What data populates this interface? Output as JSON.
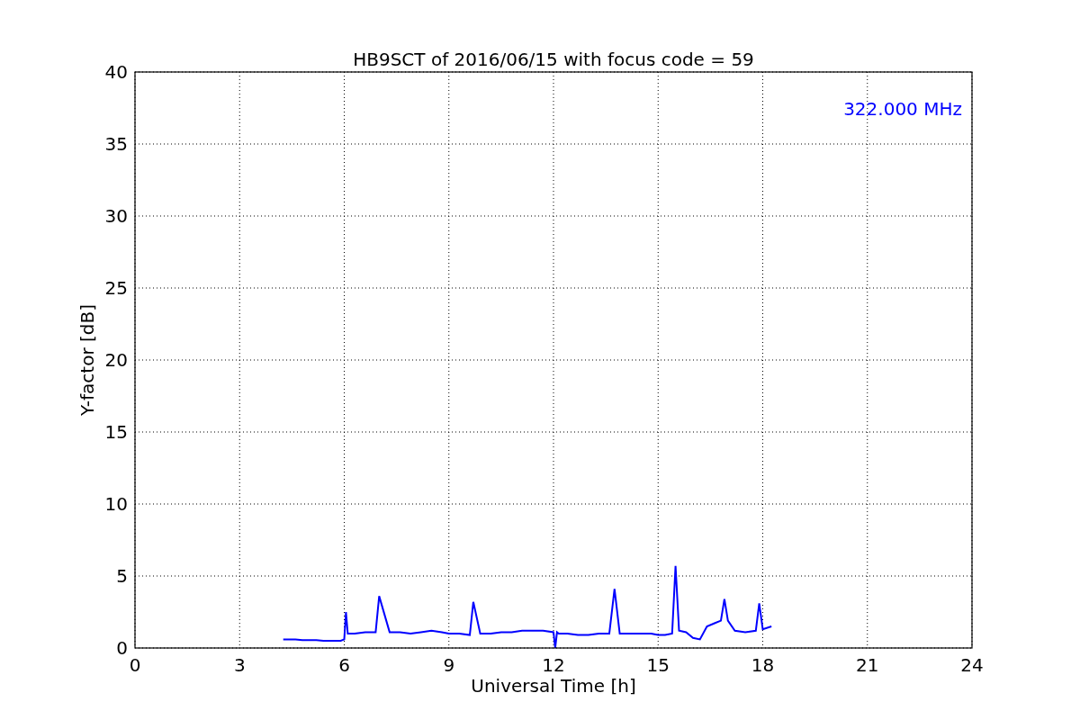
{
  "chart_data": {
    "type": "line",
    "title": "HB9SCT of 2016/06/15 with focus code = 59",
    "xlabel": "Universal Time [h]",
    "ylabel": "Y-factor [dB]",
    "x": [
      4.25,
      4.4,
      4.6,
      4.8,
      5.0,
      5.2,
      5.4,
      5.6,
      5.75,
      5.9,
      6.0,
      6.05,
      6.1,
      6.3,
      6.6,
      6.9,
      7.0,
      7.3,
      7.6,
      7.9,
      8.2,
      8.5,
      8.8,
      9.0,
      9.3,
      9.6,
      9.7,
      9.9,
      10.2,
      10.5,
      10.8,
      11.1,
      11.4,
      11.7,
      12.0,
      12.05,
      12.1,
      12.15,
      12.4,
      12.7,
      13.0,
      13.3,
      13.6,
      13.75,
      13.9,
      14.2,
      14.5,
      14.8,
      15.0,
      15.2,
      15.4,
      15.5,
      15.6,
      15.8,
      16.0,
      16.2,
      16.4,
      16.6,
      16.8,
      16.9,
      17.0,
      17.2,
      17.5,
      17.8,
      17.9,
      18.0,
      18.25
    ],
    "values": [
      0.6,
      0.6,
      0.6,
      0.55,
      0.55,
      0.55,
      0.5,
      0.5,
      0.5,
      0.5,
      0.6,
      2.5,
      1.0,
      1.0,
      1.1,
      1.1,
      3.6,
      1.1,
      1.1,
      1.0,
      1.1,
      1.2,
      1.1,
      1.0,
      1.0,
      0.9,
      3.2,
      1.0,
      1.0,
      1.1,
      1.1,
      1.2,
      1.2,
      1.2,
      1.1,
      0.0,
      1.1,
      1.0,
      1.0,
      0.9,
      0.9,
      1.0,
      1.0,
      4.1,
      1.0,
      1.0,
      1.0,
      1.0,
      0.9,
      0.9,
      1.0,
      5.7,
      1.2,
      1.1,
      0.7,
      0.6,
      1.5,
      1.7,
      1.9,
      3.4,
      1.9,
      1.2,
      1.1,
      1.2,
      3.1,
      1.3,
      1.5
    ],
    "xlim": [
      0,
      24
    ],
    "ylim": [
      0,
      40
    ],
    "xticks": [
      0,
      3,
      6,
      9,
      12,
      15,
      18,
      21,
      24
    ],
    "yticks": [
      0,
      5,
      10,
      15,
      20,
      25,
      30,
      35,
      40
    ],
    "grid": true,
    "annotations": [
      "322.000 MHz"
    ]
  }
}
